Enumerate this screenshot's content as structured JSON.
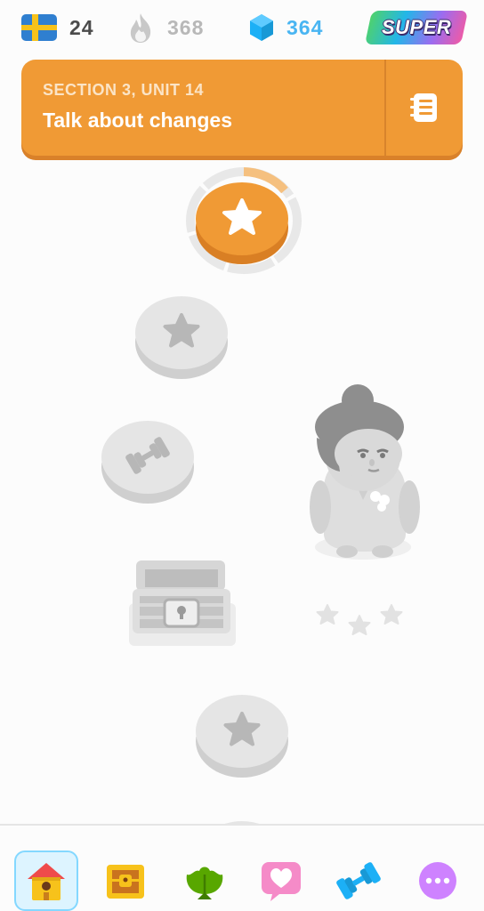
{
  "status_bar": {
    "language_flag": {
      "icon": "sweden-flag-icon",
      "value": "24"
    },
    "streak": {
      "icon": "flame-icon",
      "value": "368"
    },
    "gems": {
      "icon": "gem-icon",
      "value": "364"
    },
    "super_badge": {
      "label": "SUPER"
    }
  },
  "unit_banner": {
    "section_label": "SECTION 3, UNIT 14",
    "title": "Talk about changes",
    "guidebook_icon": "guidebook-icon",
    "color": "#f09a35"
  },
  "path": {
    "nodes": [
      {
        "type": "lesson",
        "icon": "star-icon",
        "state": "current"
      },
      {
        "type": "lesson",
        "icon": "star-icon",
        "state": "locked"
      },
      {
        "type": "practice",
        "icon": "dumbbell-icon",
        "state": "locked"
      },
      {
        "type": "chest",
        "icon": "treasure-chest-icon",
        "state": "locked"
      },
      {
        "type": "lesson",
        "icon": "star-icon",
        "state": "locked"
      }
    ],
    "current_progress_fraction": 0.2
  },
  "bottom_nav": {
    "items": [
      {
        "name": "learn",
        "icon": "home-icon",
        "active": true
      },
      {
        "name": "leagues",
        "icon": "treasure-chest-icon",
        "active": false
      },
      {
        "name": "quests",
        "icon": "shell-icon",
        "active": false
      },
      {
        "name": "profile",
        "icon": "heart-message-icon",
        "active": false
      },
      {
        "name": "practice",
        "icon": "dumbbell-icon",
        "active": false
      },
      {
        "name": "more",
        "icon": "more-icon",
        "active": false
      }
    ]
  },
  "colors": {
    "orange": "#f09a35",
    "streak_gray": "#b8b8b8",
    "gem_blue": "#49b5f2",
    "locked_gray": "#e5e5e5",
    "active_nav_bg": "#ddf4ff"
  }
}
